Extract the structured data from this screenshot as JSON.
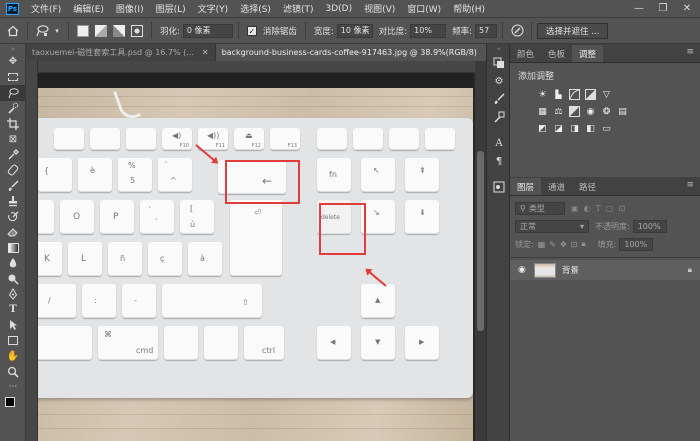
{
  "menubar": {
    "app_badge": "Ps",
    "items": [
      "文件(F)",
      "编辑(E)",
      "图像(I)",
      "图层(L)",
      "文字(Y)",
      "选择(S)",
      "滤镜(T)",
      "3D(D)",
      "视图(V)",
      "窗口(W)",
      "帮助(H)"
    ],
    "minimize": "—",
    "restore": "❐",
    "close": "✕"
  },
  "options": {
    "feather_label": "羽化:",
    "feather_value": "0 像素",
    "antialias_label": "消除锯齿",
    "width_label": "宽度:",
    "width_value": "10 像素",
    "contrast_label": "对比度:",
    "contrast_value": "10%",
    "frequency_label": "频率:",
    "frequency_value": "57",
    "select_mask_button": "选择并遮住 ..."
  },
  "tabs": [
    {
      "label": "taoxuemei-磁性套索工具.psd @ 16.7% (...",
      "close": "✕",
      "active": false
    },
    {
      "label": "background-business-cards-coffee-917463.jpg @ 38.9%(RGB/8)",
      "close": "✕",
      "active": true
    }
  ],
  "keys": {
    "fn": "fn",
    "delete": "delete",
    "cmd": "cmd",
    "ctrl": "ctrl",
    "f10": "F10",
    "f11": "F11",
    "f12": "F12",
    "f13": "F13",
    "o": "O",
    "p": "P",
    "l": "L",
    "k": "K",
    "e_grave": "è",
    "e_acute": "é",
    "a_grave": "à",
    "c_cedilla": "ç",
    "u_acute": "ú",
    "o_umlaut": "ö",
    "n_tilde": "ñ"
  },
  "right_panel": {
    "top_tabs": [
      "颜色",
      "色板",
      "调整"
    ],
    "active_top_tab": "调整",
    "adjust_title": "添加调整",
    "layer_tabs": [
      "图层",
      "通道",
      "路径"
    ],
    "active_layer_tab": "图层",
    "kind_filter": "类型",
    "blend_mode": "正常",
    "opacity_label": "不透明度:",
    "opacity_value": "100%",
    "lock_label": "锁定:",
    "fill_label": "填充:",
    "fill_value": "100%",
    "layer_name": "背景"
  },
  "colors": {
    "highlight": "#e03c3c",
    "panel_bg": "#535353",
    "dark_bg": "#424242"
  }
}
